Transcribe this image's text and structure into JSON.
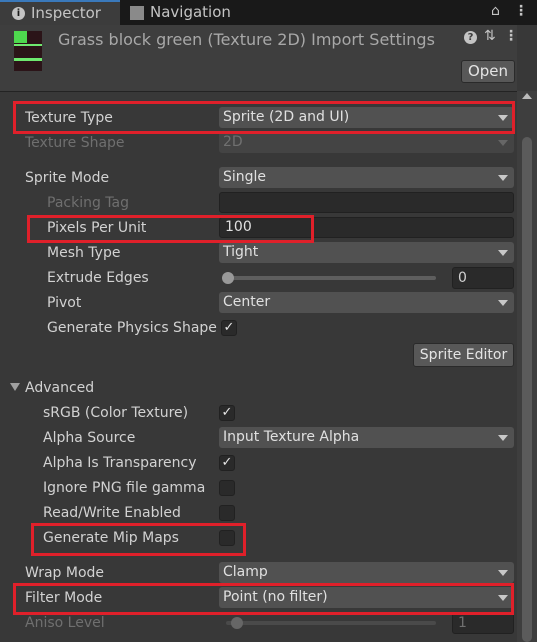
{
  "tabs": [
    {
      "label": "Inspector",
      "icon": "info-icon"
    },
    {
      "label": "Navigation",
      "icon": "navigation-icon"
    }
  ],
  "header": {
    "title": "Grass block green (Texture 2D) Import Settings",
    "open_label": "Open"
  },
  "fields": {
    "texture_type": {
      "label": "Texture Type",
      "value": "Sprite (2D and UI)"
    },
    "texture_shape": {
      "label": "Texture Shape",
      "value": "2D"
    },
    "sprite_mode": {
      "label": "Sprite Mode",
      "value": "Single"
    },
    "packing_tag": {
      "label": "Packing Tag",
      "value": ""
    },
    "pixels_per_unit": {
      "label": "Pixels Per Unit",
      "value": "100"
    },
    "mesh_type": {
      "label": "Mesh Type",
      "value": "Tight"
    },
    "extrude_edges": {
      "label": "Extrude Edges",
      "value": "0"
    },
    "pivot": {
      "label": "Pivot",
      "value": "Center"
    },
    "generate_physics_shape": {
      "label": "Generate Physics Shape",
      "checked": true
    },
    "sprite_editor_label": "Sprite Editor",
    "advanced_label": "Advanced",
    "srgb": {
      "label": "sRGB (Color Texture)",
      "checked": true
    },
    "alpha_source": {
      "label": "Alpha Source",
      "value": "Input Texture Alpha"
    },
    "alpha_is_transparency": {
      "label": "Alpha Is Transparency",
      "checked": true
    },
    "ignore_png_gamma": {
      "label": "Ignore PNG file gamma",
      "checked": false
    },
    "read_write": {
      "label": "Read/Write Enabled",
      "checked": false
    },
    "generate_mip_maps": {
      "label": "Generate Mip Maps",
      "checked": false
    },
    "wrap_mode": {
      "label": "Wrap Mode",
      "value": "Clamp"
    },
    "filter_mode": {
      "label": "Filter Mode",
      "value": "Point (no filter)"
    },
    "aniso_level": {
      "label": "Aniso Level",
      "value": "1"
    }
  },
  "check_glyph": "✓",
  "highlight_color": "#e0202a"
}
